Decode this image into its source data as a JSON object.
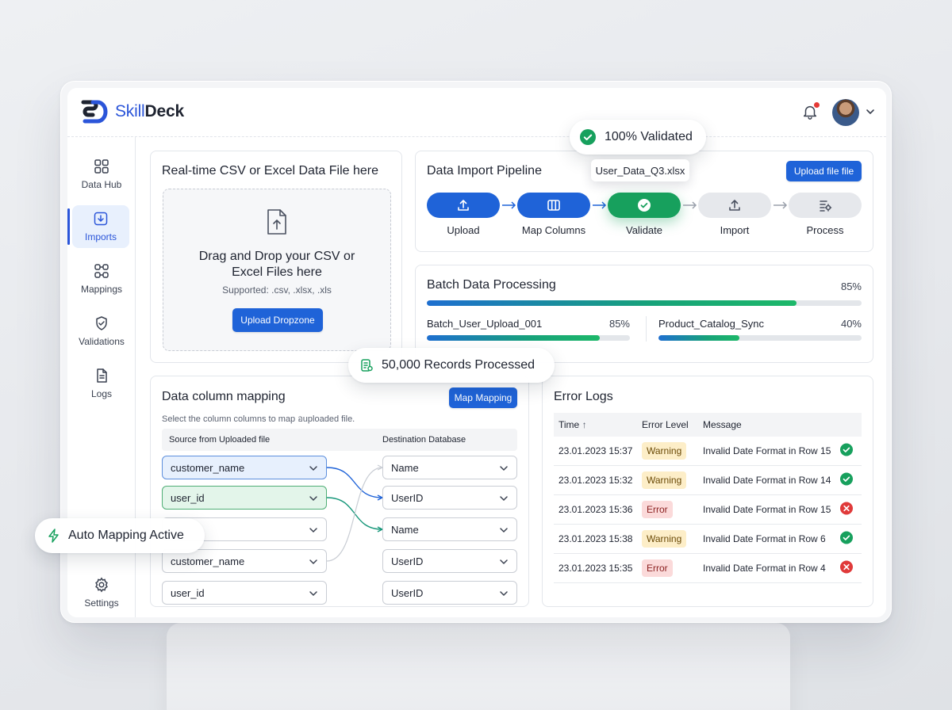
{
  "app": {
    "name_part1": "Skill",
    "name_part2": "Deck"
  },
  "sidebar": {
    "items": [
      {
        "label": "Data Hub",
        "icon": "grid-icon"
      },
      {
        "label": "Imports",
        "icon": "import-icon",
        "active": true
      },
      {
        "label": "Mappings",
        "icon": "mapping-icon"
      },
      {
        "label": "Validations",
        "icon": "shield-check-icon"
      },
      {
        "label": "Logs",
        "icon": "document-icon"
      }
    ],
    "settings_label": "Settings"
  },
  "upload_card": {
    "title": "Real-time CSV or Excel Data File here",
    "drop_title": "Drag and Drop your CSV or Excel Files here",
    "supported": "Supported: .csv, .xlsx, .xls",
    "button": "Upload Dropzone"
  },
  "pipeline": {
    "title": "Data Import Pipeline",
    "upload_button": "Upload  file file",
    "file_tooltip": "User_Data_Q3.xlsx",
    "steps": [
      {
        "label": "Upload",
        "state": "done"
      },
      {
        "label": "Map Columns",
        "state": "done"
      },
      {
        "label": "Validate",
        "state": "current"
      },
      {
        "label": "Import",
        "state": "pending"
      },
      {
        "label": "Process",
        "state": "pending"
      }
    ]
  },
  "batch": {
    "title": "Batch Data Processing",
    "overall_pct_label": "85%",
    "overall_progress": 0.85,
    "jobs": [
      {
        "name": "Batch_User_Upload_001",
        "pct_label": "85%",
        "progress": 0.85
      },
      {
        "name": "Product_Catalog_Sync",
        "pct_label": "40%",
        "progress": 0.4
      }
    ]
  },
  "mapping": {
    "title": "Data column mapping",
    "subtitle": "Select the column columns to map อuploaded file.",
    "button": "Map Mapping",
    "col_source": "Source from Uploaded file",
    "col_dest": "Destination Database",
    "sources": [
      "customer_name",
      "user_id",
      "",
      "customer_name",
      "user_id"
    ],
    "destinations": [
      "Name",
      "UserID",
      "Name",
      "UserID",
      "UserID"
    ]
  },
  "error_logs": {
    "title": "Error Logs",
    "headers": {
      "time": "Time",
      "level": "Error Level",
      "message": "Message"
    },
    "rows": [
      {
        "time": "23.01.2023 15:37",
        "level": "Warning",
        "message": "Invalid Date Format in Row 15",
        "status": "resolved"
      },
      {
        "time": "23.01.2023 15:32",
        "level": "Warning",
        "message": "Invalid Date Format in Row 14",
        "status": "resolved"
      },
      {
        "time": "23.01.2023 15:36",
        "level": "Error",
        "message": "Invalid Date Format in Row 15",
        "status": "failed"
      },
      {
        "time": "23.01.2023 15:38",
        "level": "Warning",
        "message": "Invalid Date Format in Row 6",
        "status": "resolved"
      },
      {
        "time": "23.01.2023 15:35",
        "level": "Error",
        "message": "Invalid Date Format in Row 4",
        "status": "failed"
      }
    ]
  },
  "floats": {
    "validated": "100% Validated",
    "records": "50,000 Records Processed",
    "auto_mapping": "Auto Mapping Active"
  },
  "colors": {
    "primary": "#1f63d8",
    "success": "#17a05d",
    "error": "#e03a3a",
    "warning_bg": "#fdeec8",
    "error_bg": "#fbdada"
  }
}
